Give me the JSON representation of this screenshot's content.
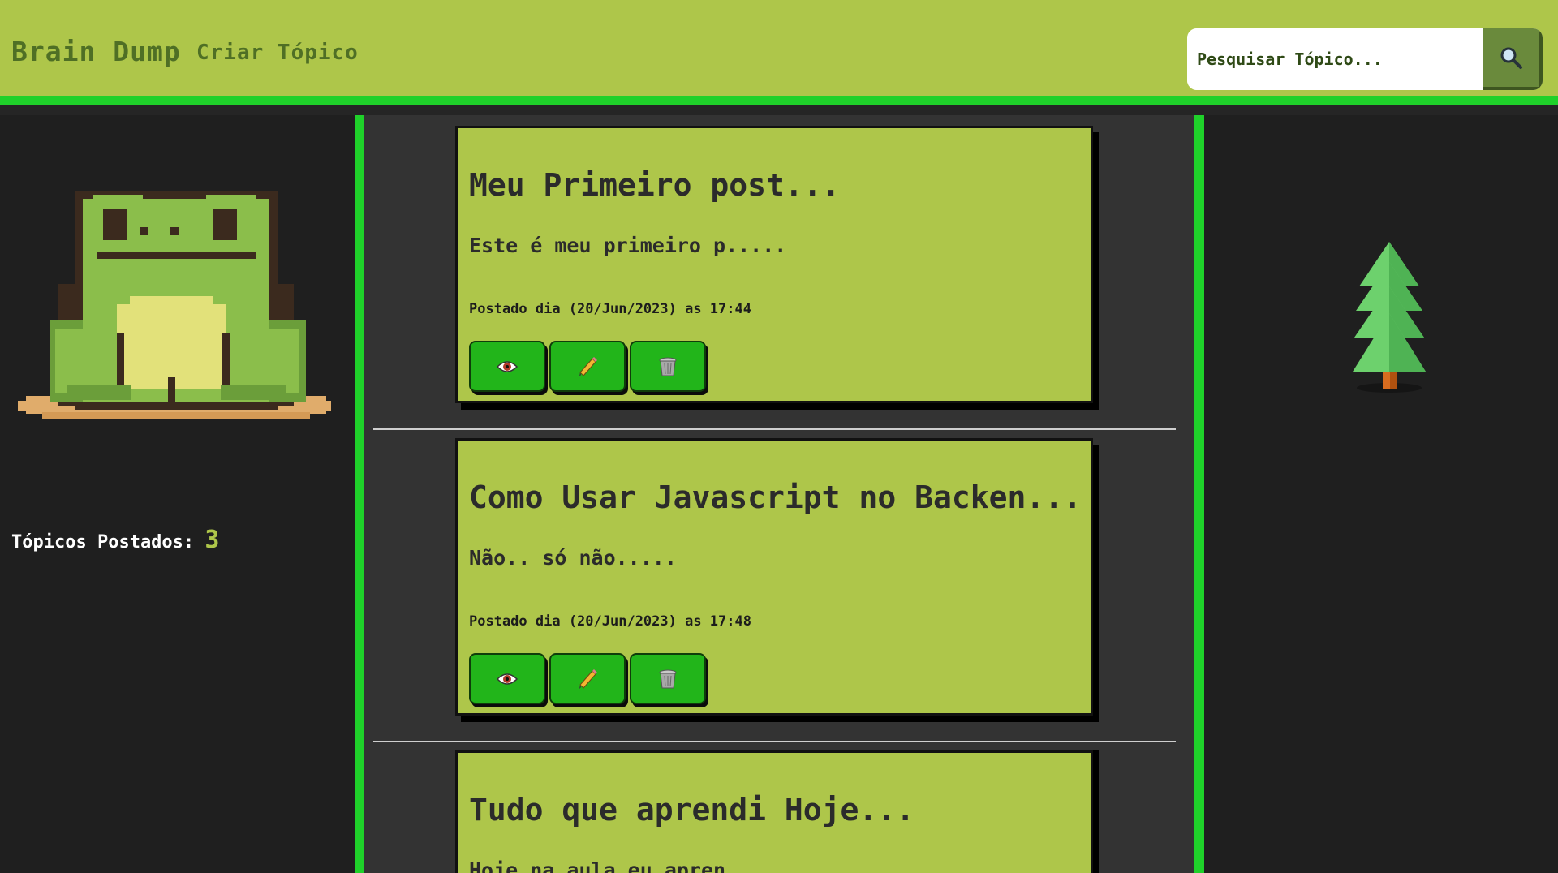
{
  "header": {
    "brand": "Brain Dump",
    "create_topic": "Criar Tópico",
    "search": {
      "placeholder": "Pesquisar Tópico...",
      "button_icon": "search-icon"
    }
  },
  "sidebar": {
    "stats_label": "Tópicos Postados:",
    "stats_count": "3"
  },
  "posts": [
    {
      "title": "Meu Primeiro post...",
      "excerpt": "Este é meu primeiro p.....",
      "meta": "Postado dia (20/Jun/2023) as 17:44",
      "actions": [
        "eye-icon",
        "pencil-icon",
        "trash-icon"
      ]
    },
    {
      "title": "Como Usar Javascript no Backen...",
      "excerpt": "Não.. só não.....",
      "meta": "Postado dia (20/Jun/2023) as 17:48",
      "actions": [
        "eye-icon",
        "pencil-icon",
        "trash-icon"
      ]
    },
    {
      "title": "Tudo que aprendi Hoje...",
      "excerpt": "Hoje na aula eu apren"
    }
  ],
  "colors": {
    "header_bg": "#aec64a",
    "accent_green": "#1fd12a",
    "button_green": "#22b51a",
    "panel_dark": "#1f1f1f",
    "center_bg": "#333333"
  }
}
